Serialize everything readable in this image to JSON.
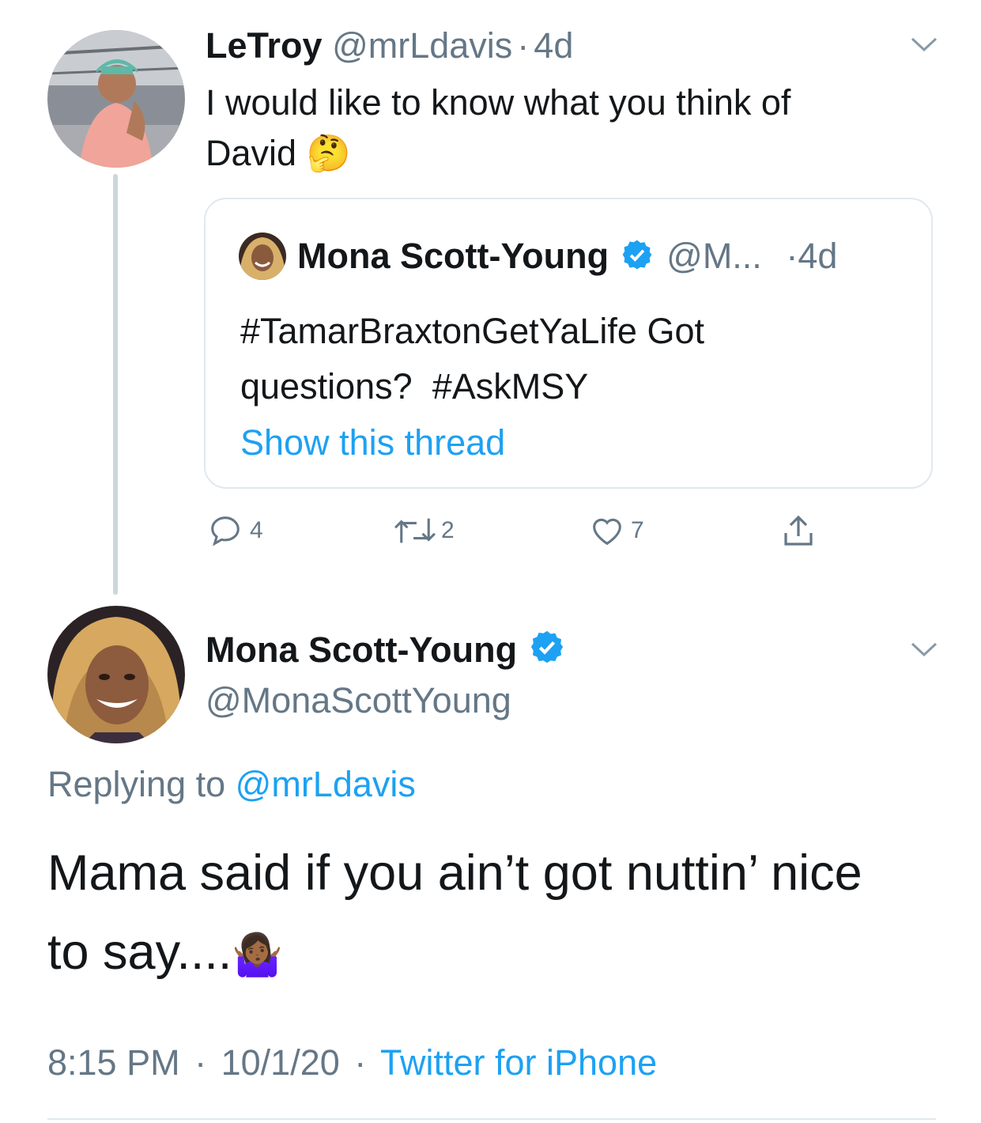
{
  "parent_tweet": {
    "author_name": "LeTroy",
    "author_handle": "@mrLdavis",
    "time_sep": "·",
    "time": "4d",
    "text_line1": "I would like to know what you think of",
    "text_line2": "David",
    "emoji": "🤔",
    "quoted": {
      "author_name": "Mona Scott-Young",
      "author_handle": "@M...",
      "time_sep": "·",
      "time": "4d",
      "hashtag1": "#TamarBraxtonGetYaLife",
      "text_after_hashtag1": "Got",
      "text_line2_start": "questions?",
      "hashtag2": "#AskMSY",
      "show_thread": "Show this thread"
    },
    "actions": {
      "replies": "4",
      "retweets": "2",
      "likes": "7"
    }
  },
  "main_tweet": {
    "author_name": "Mona Scott-Young",
    "author_handle": "@MonaScottYoung",
    "replying_prefix": "Replying to",
    "replying_handle": "@mrLdavis",
    "text_line1": "Mama said if you ain’t got nuttin’ nice",
    "text_line2": "to say....",
    "emoji": "🤷🏾‍♀️",
    "time": "8:15 PM",
    "sep1": "·",
    "date": "10/1/20",
    "sep2": "·",
    "source": "Twitter for iPhone"
  },
  "colors": {
    "accent": "#1da1f2",
    "muted": "#657786",
    "text": "#14171a",
    "border": "#e1e8ed",
    "thread_line": "#ccd6dd"
  }
}
